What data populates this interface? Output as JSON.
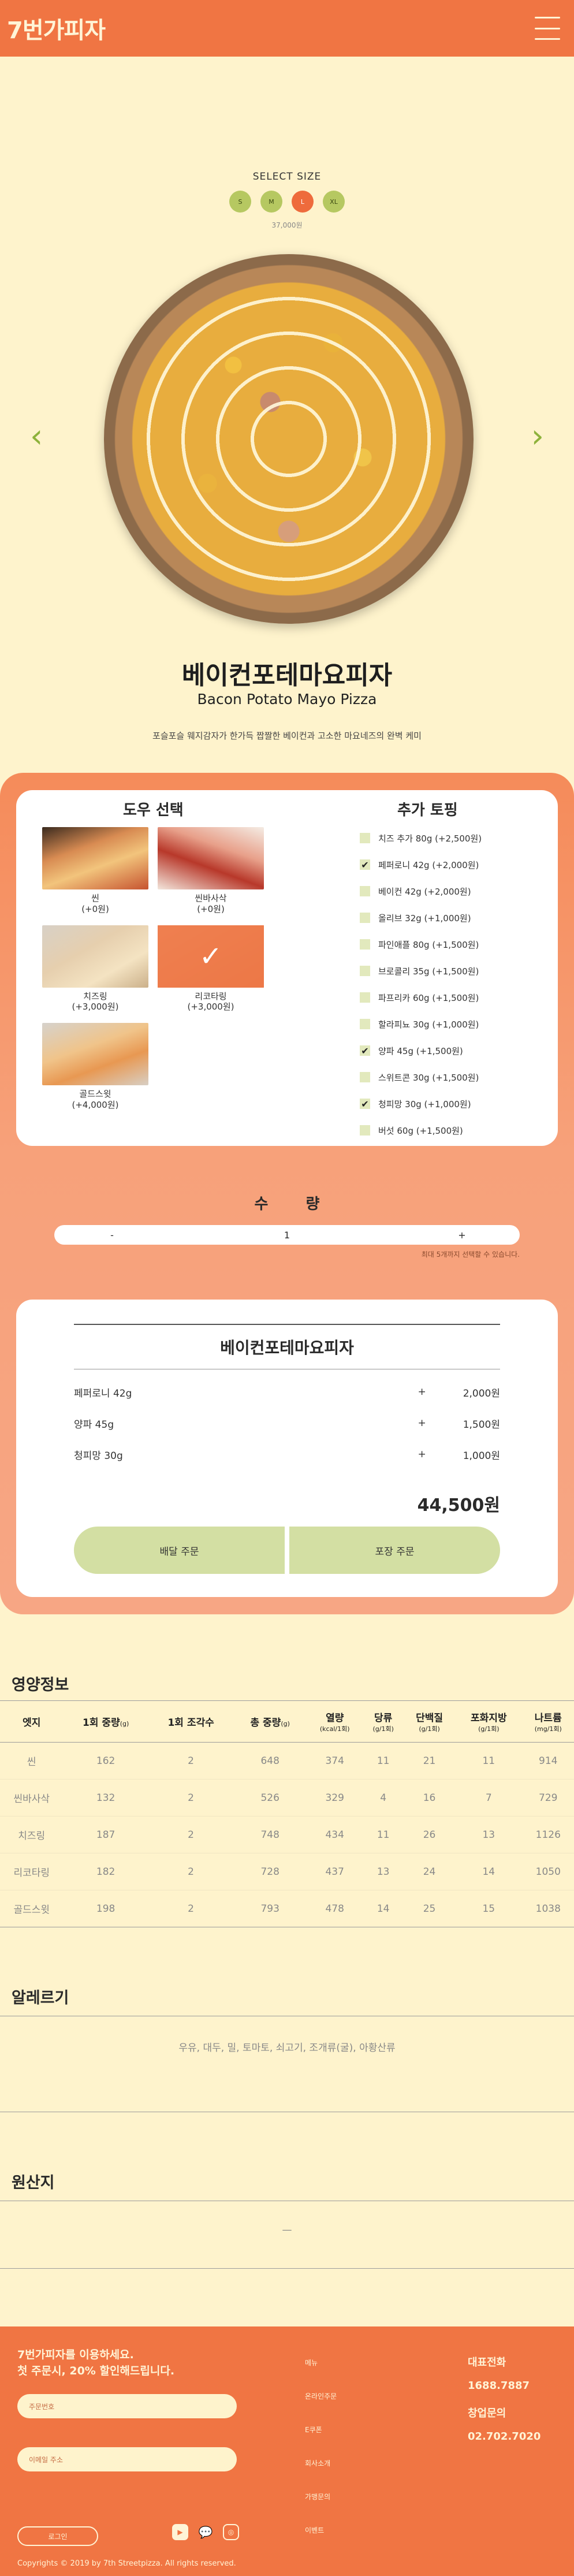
{
  "header": {
    "logo": "7번가피자",
    "menu_icon": "hamburger-icon"
  },
  "product": {
    "size_title": "SELECT SIZE",
    "sizes": [
      "S",
      "M",
      "L",
      "XL"
    ],
    "selected_size": "L",
    "price_small": "37,000원",
    "name_ko": "베이컨포테마요피자",
    "name_en": "Bacon Potato Mayo Pizza",
    "description": "포슬포슬 웨지감자가 한가득 짭짤한 베이컨과 고소한 마요네즈의 완벽 케미",
    "prev_icon": "chevron-left-icon",
    "next_icon": "chevron-right-icon"
  },
  "options": {
    "dough_title": "도우 선택",
    "topping_title": "추가 토핑",
    "doughs": [
      {
        "name": "씬",
        "price": "(+0원)",
        "selected": false
      },
      {
        "name": "씬바사삭",
        "price": "(+0원)",
        "selected": false
      },
      {
        "name": "치즈링",
        "price": "(+3,000원)",
        "selected": false
      },
      {
        "name": "리코타링",
        "price": "(+3,000원)",
        "selected": true
      },
      {
        "name": "골드스윗",
        "price": "(+4,000원)",
        "selected": false
      }
    ],
    "toppings": [
      {
        "label": "치즈 추가 80g (+2,500원)",
        "checked": false
      },
      {
        "label": "페퍼로니 42g (+2,000원)",
        "checked": true
      },
      {
        "label": "베이컨 42g (+2,000원)",
        "checked": false
      },
      {
        "label": "올리브 32g (+1,000원)",
        "checked": false
      },
      {
        "label": "파인애플 80g (+1,500원)",
        "checked": false
      },
      {
        "label": "브로콜리 35g (+1,500원)",
        "checked": false
      },
      {
        "label": "파프리카 60g (+1,500원)",
        "checked": false
      },
      {
        "label": "할라피뇨 30g (+1,000원)",
        "checked": false
      },
      {
        "label": "양파 45g (+1,500원)",
        "checked": true
      },
      {
        "label": "스위트콘 30g (+1,500원)",
        "checked": false
      },
      {
        "label": "청피망 30g (+1,000원)",
        "checked": true
      },
      {
        "label": "버섯 60g (+1,500원)",
        "checked": false
      }
    ]
  },
  "quantity": {
    "title": "수 량",
    "minus": "-",
    "value": "1",
    "plus": "+",
    "note": "최대 5개까지 선택할 수 있습니다."
  },
  "summary": {
    "title": "베이컨포테마요피자",
    "items": [
      {
        "name": "페퍼로니 42g",
        "sign": "+",
        "price": "2,000원"
      },
      {
        "name": "양파 45g",
        "sign": "+",
        "price": "1,500원"
      },
      {
        "name": "청피망 30g",
        "sign": "+",
        "price": "1,000원"
      }
    ],
    "total": "44,500원",
    "delivery_btn": "배달 주문",
    "takeout_btn": "포장 주문"
  },
  "nutrition": {
    "title": "영양정보",
    "headers": [
      {
        "main": "엣지",
        "sub": ""
      },
      {
        "main": "1회 중량",
        "sub": "(g)"
      },
      {
        "main": "1회 조각수",
        "sub": ""
      },
      {
        "main": "총 중량",
        "sub": "(g)"
      },
      {
        "main": "열량",
        "sub": "(kcal/1회)"
      },
      {
        "main": "당류",
        "sub": "(g/1회)"
      },
      {
        "main": "단백질",
        "sub": "(g/1회)"
      },
      {
        "main": "포화지방",
        "sub": "(g/1회)"
      },
      {
        "main": "나트륨",
        "sub": "(mg/1회)"
      }
    ],
    "rows": [
      [
        "씬",
        "162",
        "2",
        "648",
        "374",
        "11",
        "21",
        "11",
        "914"
      ],
      [
        "씬바사삭",
        "132",
        "2",
        "526",
        "329",
        "4",
        "16",
        "7",
        "729"
      ],
      [
        "치즈링",
        "187",
        "2",
        "748",
        "434",
        "11",
        "26",
        "13",
        "1126"
      ],
      [
        "리코타링",
        "182",
        "2",
        "728",
        "437",
        "13",
        "24",
        "14",
        "1050"
      ],
      [
        "골드스윗",
        "198",
        "2",
        "793",
        "478",
        "14",
        "25",
        "15",
        "1038"
      ]
    ]
  },
  "allergy": {
    "title": "알레르기",
    "text": "우유, 대두, 밀, 토마토, 쇠고기, 조개류(굴), 아황산류"
  },
  "origin": {
    "title": "원산지",
    "text": "—"
  },
  "footer": {
    "intro_line1": "7번가피자를 이용하세요.",
    "intro_line2": "첫 주문시, 20% 할인해드립니다.",
    "phone_placeholder": "주문번호",
    "email_placeholder": "이메일 주소",
    "login": "로그인",
    "menu": [
      "메뉴",
      "온라인주문",
      "E쿠폰",
      "회사소개",
      "가맹문의",
      "이벤트"
    ],
    "contact_title": "대표전화",
    "contact_phone": "1688.7887",
    "franchise_title": "창업문의",
    "franchise_phone": "02.702.7020",
    "copyright": "Copyrights © 2019 by 7th Streetpizza. All rights reserved."
  }
}
